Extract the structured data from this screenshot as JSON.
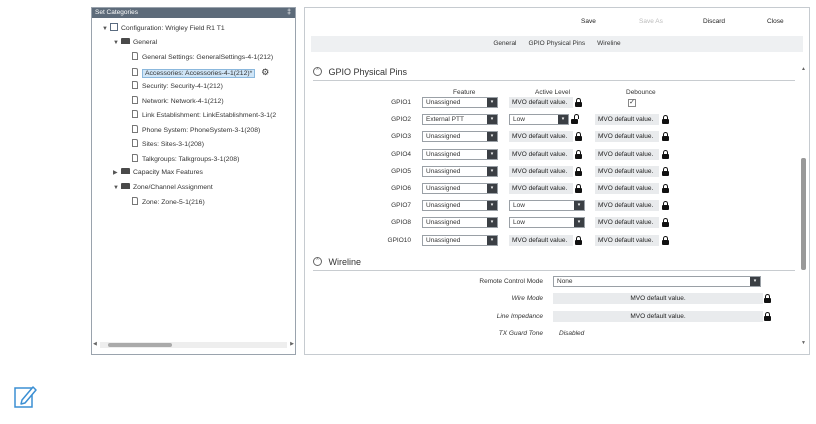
{
  "left_panel": {
    "title": "Set Categories",
    "pin": "‡",
    "tree": [
      {
        "label": "Configuration: Wrigley Field R1 T1",
        "type": "config",
        "arrow": "▼",
        "indent": 0
      },
      {
        "label": "General",
        "type": "folder-open",
        "arrow": "▼",
        "indent": 1
      },
      {
        "label": "General Settings: GeneralSettings-4-1(212)",
        "type": "doc",
        "arrow": "",
        "indent": 2
      },
      {
        "label": "Accessories: Accessories-4-1(212)*",
        "type": "doc",
        "arrow": "",
        "indent": 2,
        "selected": true
      },
      {
        "label": "Security: Security-4-1(212)",
        "type": "doc",
        "arrow": "",
        "indent": 2
      },
      {
        "label": "Network: Network-4-1(212)",
        "type": "doc",
        "arrow": "",
        "indent": 2
      },
      {
        "label": "Link Establishment: LinkEstablishment-3-1(2",
        "type": "doc",
        "arrow": "",
        "indent": 2
      },
      {
        "label": "Phone System: PhoneSystem-3-1(208)",
        "type": "doc",
        "arrow": "",
        "indent": 2
      },
      {
        "label": "Sites: Sites-3-1(208)",
        "type": "doc",
        "arrow": "",
        "indent": 2
      },
      {
        "label": "Talkgroups: Talkgroups-3-1(208)",
        "type": "doc",
        "arrow": "",
        "indent": 2
      },
      {
        "label": "Capacity Max Features",
        "type": "folder",
        "arrow": "▶",
        "indent": 1
      },
      {
        "label": "Zone/Channel Assignment",
        "type": "folder-open",
        "arrow": "▼",
        "indent": 1
      },
      {
        "label": "Zone: Zone-5-1(216)",
        "type": "doc",
        "arrow": "",
        "indent": 2
      }
    ]
  },
  "toolbar": {
    "save": "Save",
    "save_as": "Save As",
    "discard": "Discard",
    "close": "Close"
  },
  "tabs": [
    "General",
    "GPIO Physical Pins",
    "Wireline"
  ],
  "gpio": {
    "title": "GPIO Physical Pins",
    "col_feature": "Feature",
    "col_active": "Active Level",
    "col_debounce": "Debounce",
    "rows": [
      {
        "pin": "GPIO1",
        "feature": "Unassigned",
        "active": "MVO default value.",
        "active_type": "mvo",
        "debounce": "✓",
        "debounce_type": "check"
      },
      {
        "pin": "GPIO2",
        "feature": "External PTT",
        "active": "Low",
        "active_type": "select",
        "debounce": "MVO default value.",
        "debounce_type": "mvo"
      },
      {
        "pin": "GPIO3",
        "feature": "Unassigned",
        "active": "MVO default value.",
        "active_type": "mvo",
        "debounce": "MVO default value.",
        "debounce_type": "mvo"
      },
      {
        "pin": "GPIO4",
        "feature": "Unassigned",
        "active": "MVO default value.",
        "active_type": "mvo",
        "debounce": "MVO default value.",
        "debounce_type": "mvo"
      },
      {
        "pin": "GPIO5",
        "feature": "Unassigned",
        "active": "MVO default value.",
        "active_type": "mvo",
        "debounce": "MVO default value.",
        "debounce_type": "mvo"
      },
      {
        "pin": "GPIO6",
        "feature": "Unassigned",
        "active": "MVO default value.",
        "active_type": "mvo",
        "debounce": "MVO default value.",
        "debounce_type": "mvo"
      },
      {
        "pin": "GPIO7",
        "feature": "Unassigned",
        "active": "Low",
        "active_type": "select-plain",
        "debounce": "MVO default value.",
        "debounce_type": "mvo"
      },
      {
        "pin": "GPIO8",
        "feature": "Unassigned",
        "active": "Low",
        "active_type": "select-plain",
        "debounce": "MVO default value.",
        "debounce_type": "mvo"
      },
      {
        "pin": "GPIO10",
        "feature": "Unassigned",
        "active": "MVO default value.",
        "active_type": "mvo",
        "debounce": "MVO default value.",
        "debounce_type": "mvo"
      }
    ]
  },
  "wireline": {
    "title": "Wireline",
    "remote_control_mode_label": "Remote Control Mode",
    "remote_control_mode_value": "None",
    "wire_mode_label": "Wire Mode",
    "wire_mode_value": "MVO default value.",
    "line_impedance_label": "Line Impedance",
    "line_impedance_value": "MVO default value.",
    "tx_guard_tone_label": "TX Guard Tone",
    "tx_guard_tone_value": "Disabled"
  },
  "icons": {
    "collapse": "⌃",
    "dropdown": "▾",
    "gear": "⚙",
    "edit_note": "pencil-icon"
  },
  "colors": {
    "accent": "#3b8fd3",
    "dropdown_button": "#3b3f44",
    "mvo_bg": "#e9ebed"
  }
}
